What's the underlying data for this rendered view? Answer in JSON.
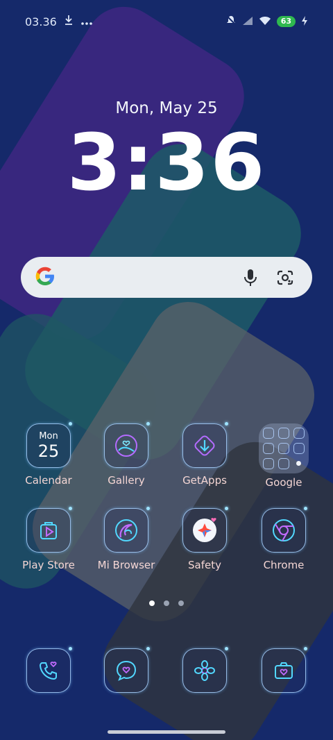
{
  "status_bar": {
    "time": "03.36",
    "battery": "63",
    "icons": [
      "download-icon",
      "more-icon",
      "notification-mute-icon",
      "signal-icon",
      "wifi-icon",
      "battery-icon",
      "charging-icon"
    ]
  },
  "clock": {
    "date": "Mon, May 25",
    "time": "3:36"
  },
  "search": {
    "icons": [
      "google-g-icon",
      "mic-icon",
      "lens-icon"
    ]
  },
  "apps_row1": [
    {
      "label": "Calendar",
      "icon": "calendar-icon",
      "day": "Mon",
      "date": "25"
    },
    {
      "label": "Gallery",
      "icon": "gallery-icon"
    },
    {
      "label": "GetApps",
      "icon": "getapps-icon"
    },
    {
      "label": "Google",
      "icon": "folder-icon"
    }
  ],
  "apps_row2": [
    {
      "label": "Play Store",
      "icon": "play-store-icon"
    },
    {
      "label": "Mi Browser",
      "icon": "browser-icon"
    },
    {
      "label": "Safety",
      "icon": "safety-icon"
    },
    {
      "label": "Chrome",
      "icon": "chrome-icon"
    }
  ],
  "dock": [
    {
      "icon": "phone-icon"
    },
    {
      "icon": "messages-icon"
    },
    {
      "icon": "flower-icon"
    },
    {
      "icon": "camera-icon"
    }
  ],
  "page_indicator": {
    "count": 3,
    "active": 1
  },
  "colors": {
    "background": "#15296a",
    "label": "#f4d6d4",
    "icon_outline": "#aad2ff",
    "battery": "#2fb84f"
  }
}
